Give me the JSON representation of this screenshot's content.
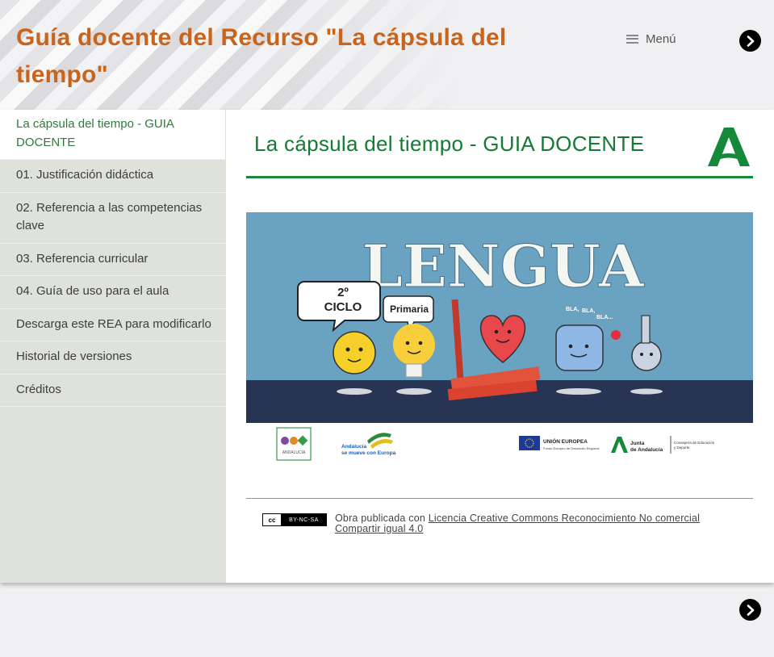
{
  "header": {
    "site_title": "Guía docente del Recurso \"La cápsula del tiempo\"",
    "menu_label": "Menú"
  },
  "sidebar": {
    "items": [
      {
        "label": "La cápsula del tiempo - GUIA DOCENTE",
        "active": true
      },
      {
        "label": "01. Justificación didáctica"
      },
      {
        "label": "02. Referencia a las competencias clave"
      },
      {
        "label": "03. Referencia curricular"
      },
      {
        "label": "04. Guía de uso para el aula"
      },
      {
        "label": "Descarga este REA para modificarlo"
      },
      {
        "label": "Historial de versiones"
      },
      {
        "label": "Créditos"
      }
    ]
  },
  "main": {
    "page_title": "La cápsula del tiempo - GUIA DOCENTE",
    "banner": {
      "title": "LENGUA",
      "bubble_1_line1": "2º",
      "bubble_1_line2": "CICLO",
      "bubble_2": "Primaria",
      "bla_1": "BLA,",
      "bla_2": "BLA,",
      "bla_3": "BLA..."
    },
    "logos": {
      "rea_text": "ANDALUCÍA",
      "andalucia_line1": "Andalucía",
      "andalucia_line2": "se mueve con Europa",
      "eu_line1": "UNIÓN EUROPEA",
      "eu_line2": "Fondo Europeo de Desarrollo Regional",
      "junta_line1": "Junta",
      "junta_line2": "de Andalucía",
      "consejeria_line1": "Consejería de Educación",
      "consejeria_line2": "y Deporte"
    },
    "license": {
      "badge_text": "BY-NC-SA",
      "badge_cc": "cc",
      "prefix": "Obra publicada con ",
      "link": "Licencia Creative Commons Reconocimiento No comercial Compartir igual 4.0"
    }
  },
  "colors": {
    "title_orange": "#c8641c",
    "heading_green": "#157a33",
    "sidebar_bg": "#dfe2da"
  }
}
